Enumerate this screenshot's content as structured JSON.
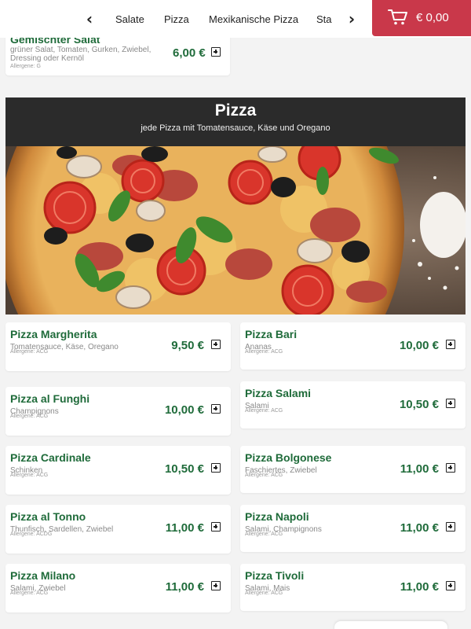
{
  "nav": {
    "prev_icon": "chevron-left-icon",
    "next_icon": "chevron-right-icon",
    "categories": [
      "Salate",
      "Pizza",
      "Mexikanische Pizza",
      "Sta"
    ]
  },
  "cart": {
    "icon": "cart-icon",
    "total": "€ 0,00",
    "color": "#c9384a"
  },
  "prev_section_item": {
    "name": "Gemischter Salat",
    "desc": "grüner Salat, Tomaten, Gurken, Zwiebel, Dressing oder Kernöl",
    "allergens": "Allergene: G",
    "price": "6,00 €"
  },
  "section": {
    "title": "Pizza",
    "subtitle": "jede Pizza mit Tomatensauce, Käse und Oregano"
  },
  "items": [
    {
      "name": "Pizza Margherita",
      "desc": "Tomatensauce, Käse, Oregano",
      "allergens": "Allergene: ACG",
      "price": "9,50 €"
    },
    {
      "name": "Pizza Bari",
      "desc": "Ananas",
      "allergens": "Allergene: ACG",
      "price": "10,00 €"
    },
    {
      "name": "Pizza al Funghi",
      "desc": "Champignons",
      "allergens": "Allergene: ACG",
      "price": "10,00 €"
    },
    {
      "name": "Pizza Salami",
      "desc": "Salami",
      "allergens": "Allergene: ACG",
      "price": "10,50 €"
    },
    {
      "name": "Pizza Cardinale",
      "desc": "Schinken",
      "allergens": "Allergene: ACG",
      "price": "10,50 €"
    },
    {
      "name": "Pizza Bolgonese",
      "desc": "Faschiertes, Zwiebel",
      "allergens": "Allergene: ACG",
      "price": "11,00 €"
    },
    {
      "name": "Pizza al Tonno",
      "desc": "Thunfisch, Sardellen, Zwiebel",
      "allergens": "Allergene: ACDG",
      "price": "11,00 €"
    },
    {
      "name": "Pizza Napoli",
      "desc": "Salami, Champignons",
      "allergens": "Allergene: ACG",
      "price": "11,00 €"
    },
    {
      "name": "Pizza Milano",
      "desc": "Salami, Zwiebel",
      "allergens": "Allergene: ACG",
      "price": "11,00 €"
    },
    {
      "name": "Pizza Tivoli",
      "desc": "Salami, Mais",
      "allergens": "Allergene: ACG",
      "price": "11,00 €"
    }
  ],
  "colors": {
    "accent_green": "#1f6b3a",
    "cart_red": "#c9384a",
    "header_dark": "#2b2b2b"
  },
  "icons": {
    "add": "add-to-cart-icon",
    "hero": "pizza-photo"
  }
}
